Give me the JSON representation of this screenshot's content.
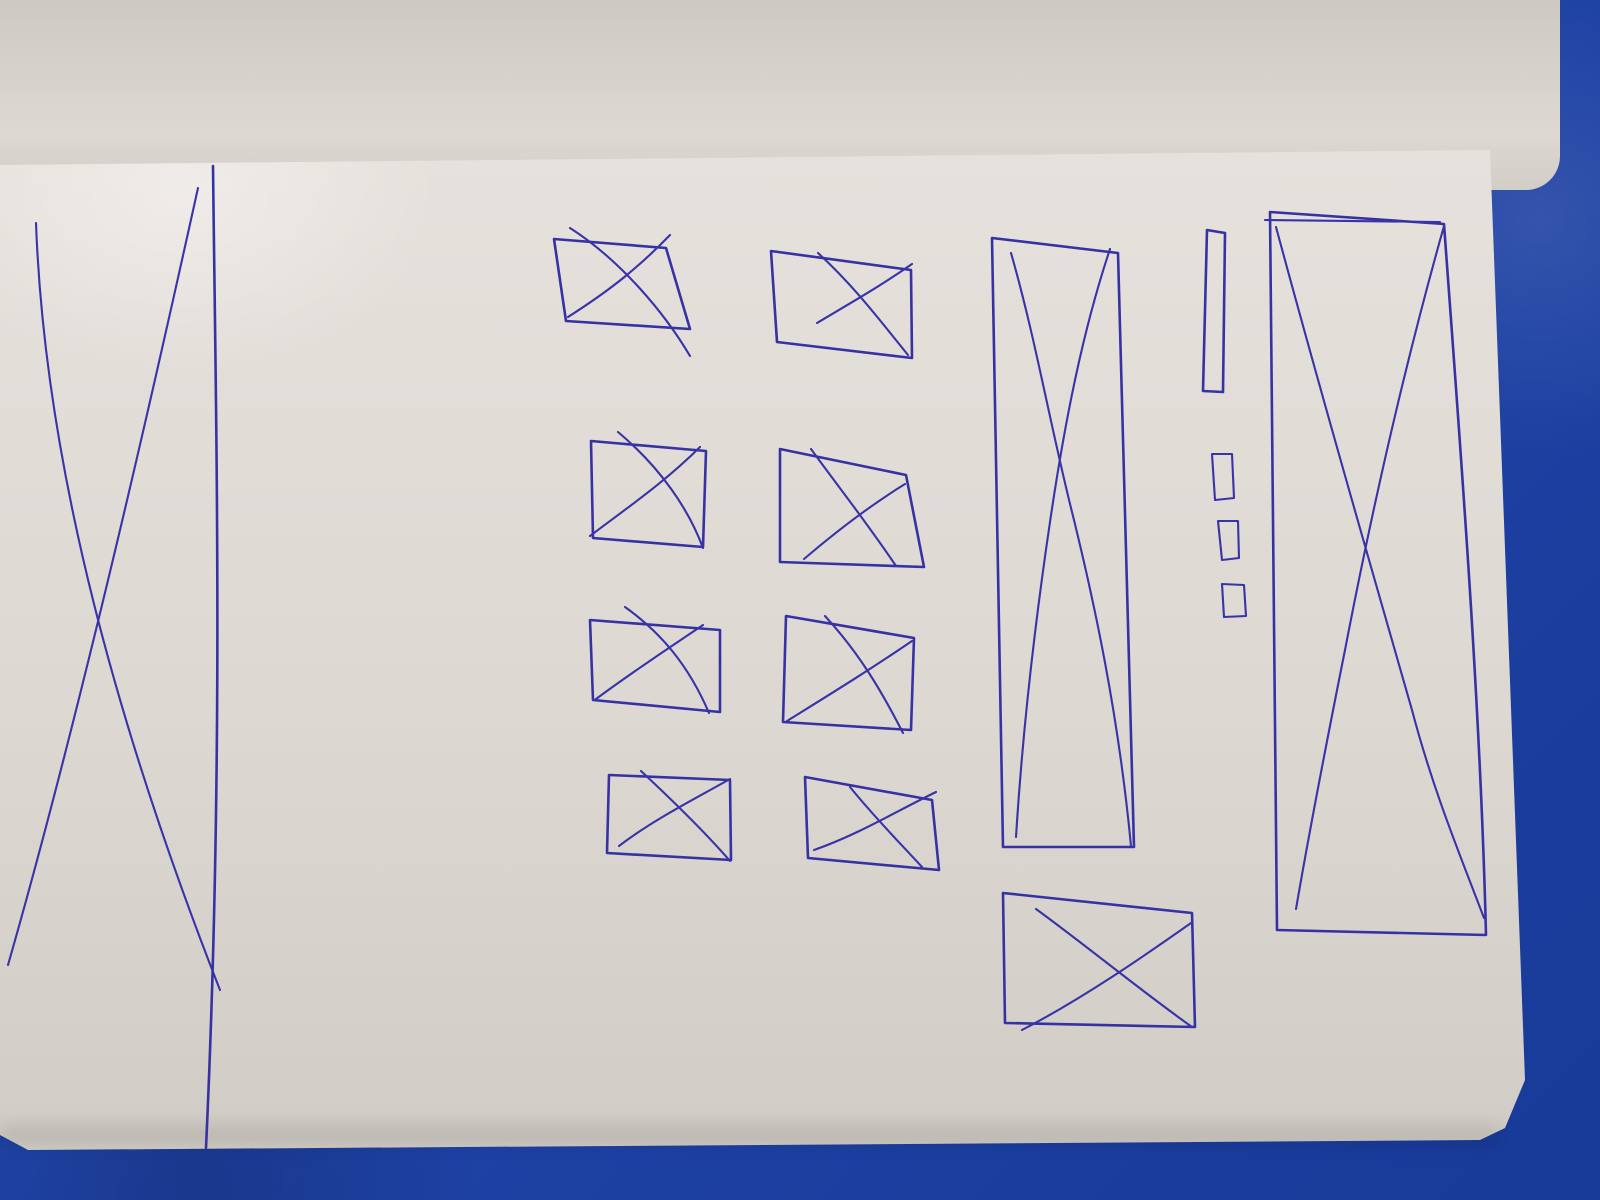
{
  "scene": {
    "type": "hand-drawn-wireframe"
  },
  "colors": {
    "ink": "#3632a3",
    "paper": "#e2ddd8",
    "background": "#1f43a8"
  },
  "placeholders": {
    "left_panel": "crossed-rectangle",
    "thumbnail_grid_columns": 2,
    "thumbnail_grid_rows": 4,
    "detail_panel": "crossed-rectangle",
    "lower_preview": "crossed-rectangle",
    "right_panel": "crossed-rectangle",
    "small_controls": 4
  }
}
